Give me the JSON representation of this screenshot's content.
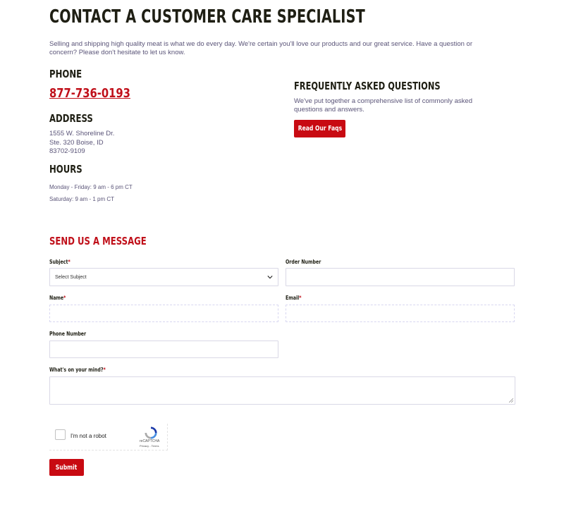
{
  "page": {
    "title": "CONTACT A CUSTOMER CARE SPECIALIST",
    "intro": "Selling and shipping high quality meat is what we do every day. We're certain you'll love our products and our great service. Have a question or concern? Please don't hesitate to let us know."
  },
  "phone": {
    "heading": "PHONE",
    "number": "877-736-0193"
  },
  "address": {
    "heading": "ADDRESS",
    "line1": "1555 W. Shoreline Dr.",
    "line2": "Ste. 320 Boise, ID",
    "line3": "83702-9109"
  },
  "hours": {
    "heading": "HOURS",
    "weekday": "Monday - Friday: 9 am - 6 pm CT",
    "saturday": "Saturday: 9 am - 1 pm CT"
  },
  "faq": {
    "heading": "FREQUENTLY ASKED QUESTIONS",
    "text": "We've put together a comprehensive list of commonly asked questions and answers.",
    "button": "Read Our Faqs"
  },
  "form": {
    "heading": "SEND US A MESSAGE",
    "required_marker": "*",
    "subject": {
      "label": "Subject",
      "value": "Select Subject"
    },
    "order_number": {
      "label": "Order Number",
      "value": ""
    },
    "name": {
      "label": "Name",
      "value": ""
    },
    "email": {
      "label": "Email",
      "value": ""
    },
    "phone_number": {
      "label": "Phone Number",
      "value": ""
    },
    "message": {
      "label": "What's on your mind?",
      "value": ""
    },
    "submit": "Submit"
  },
  "recaptcha": {
    "label": "I'm not a robot",
    "brand": "reCAPTCHA",
    "links": "Privacy - Terms"
  },
  "colors": {
    "accent": "#c80a12",
    "heading": "#1f1f14",
    "body_text": "#5a5478"
  }
}
